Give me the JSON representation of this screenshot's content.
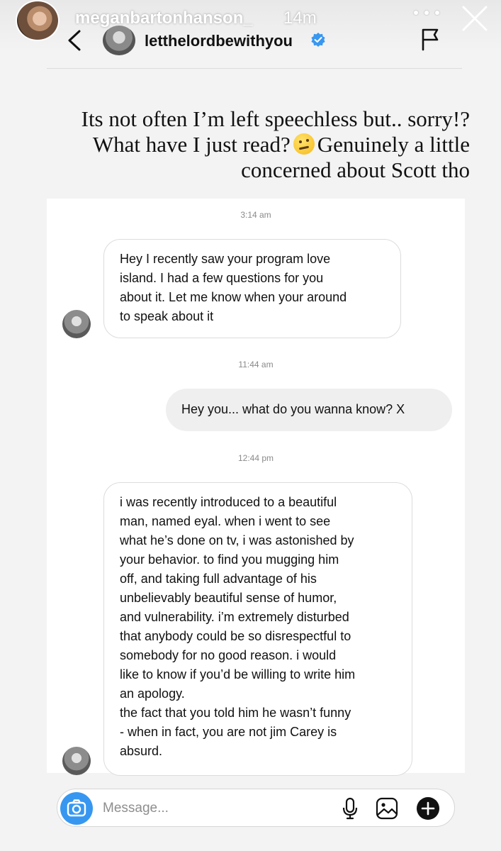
{
  "story": {
    "username": "meganbartonhanson_",
    "time": "14m"
  },
  "dm_header": {
    "name": "letthelordbewithyou"
  },
  "caption": {
    "lines": [
      "Its not often I’m left speechless but.. sorry!?",
      "What have I just read?",
      "Genuinely a little",
      "concerned about Scott tho"
    ]
  },
  "messages": {
    "ts1": "3:14 am",
    "msg1": [
      "Hey I recently saw your program love",
      "island. I had a few questions for you",
      "about it. Let me know when your around",
      "to speak about it"
    ],
    "ts2": "11:44 am",
    "msg2": "Hey you... what do you wanna know? X",
    "ts3": "12:44 pm",
    "msg3": [
      "i was recently introduced to a beautiful",
      "man, named eyal. when i went to see",
      "what he’s done on tv, i was astonished by",
      "your behavior. to find you mugging him",
      "off, and taking full advantage of his",
      "unbelievably beautiful sense of humor,",
      "and vulnerability. i’m extremely disturbed",
      "that anybody could be so disrespectful to",
      "somebody for no good  reason. i would",
      "like to know if you’d be willing to write him",
      "an apology.",
      "the fact that you told him he wasn’t funny",
      "- when in fact, you are not jim Carey is",
      "absurd."
    ]
  },
  "composer": {
    "placeholder": "Message..."
  },
  "colors": {
    "accent": "#3797f0",
    "verified": "#3897f0"
  }
}
